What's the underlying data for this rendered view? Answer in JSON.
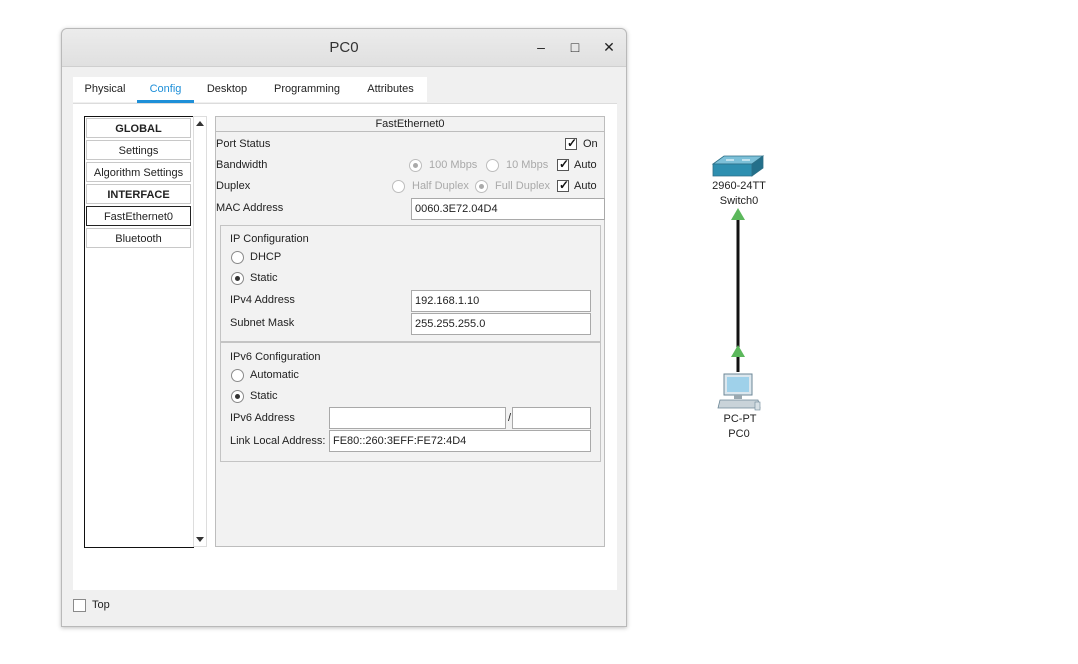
{
  "window": {
    "title": "PC0",
    "controls": {
      "minimize": "–",
      "maximize": "□",
      "close": "✕"
    }
  },
  "tabs": [
    {
      "label": "Physical",
      "active": false
    },
    {
      "label": "Config",
      "active": true
    },
    {
      "label": "Desktop",
      "active": false
    },
    {
      "label": "Programming",
      "active": false
    },
    {
      "label": "Attributes",
      "active": false
    }
  ],
  "sidebar": {
    "items": [
      {
        "label": "GLOBAL",
        "type": "header"
      },
      {
        "label": "Settings",
        "type": "item"
      },
      {
        "label": "Algorithm Settings",
        "type": "item"
      },
      {
        "label": "INTERFACE",
        "type": "header"
      },
      {
        "label": "FastEthernet0",
        "type": "item",
        "selected": true
      },
      {
        "label": "Bluetooth",
        "type": "item"
      }
    ]
  },
  "interface": {
    "title": "FastEthernet0",
    "port_status": {
      "label": "Port Status",
      "on_label": "On",
      "on_checked": true
    },
    "bandwidth": {
      "label": "Bandwidth",
      "options": [
        "100 Mbps",
        "10 Mbps"
      ],
      "selected": "100 Mbps",
      "auto_label": "Auto",
      "auto_checked": true
    },
    "duplex": {
      "label": "Duplex",
      "options": [
        "Half Duplex",
        "Full Duplex"
      ],
      "selected": "Full Duplex",
      "auto_label": "Auto",
      "auto_checked": true
    },
    "mac": {
      "label": "MAC Address",
      "value": "0060.3E72.04D4"
    },
    "ipv4": {
      "title": "IP Configuration",
      "dhcp_label": "DHCP",
      "static_label": "Static",
      "mode": "Static",
      "address_label": "IPv4 Address",
      "address": "192.168.1.10",
      "mask_label": "Subnet Mask",
      "mask": "255.255.255.0"
    },
    "ipv6": {
      "title": "IPv6 Configuration",
      "auto_label": "Automatic",
      "static_label": "Static",
      "mode": "Static",
      "address_label": "IPv6 Address",
      "address": "",
      "prefix_sep": "/",
      "prefix": "",
      "link_local_label": "Link Local Address:",
      "link_local": "FE80::260:3EFF:FE72:4D4"
    }
  },
  "footer": {
    "top_label": "Top",
    "top_checked": false
  },
  "topology": {
    "switch": {
      "model": "2960-24TT",
      "name": "Switch0"
    },
    "pc": {
      "model": "PC-PT",
      "name": "PC0"
    },
    "link_color": "#111111",
    "link_status_color": "#5cb85c"
  },
  "colors": {
    "accent": "#1e8fd8",
    "switch_body": "#2e8fb0"
  }
}
